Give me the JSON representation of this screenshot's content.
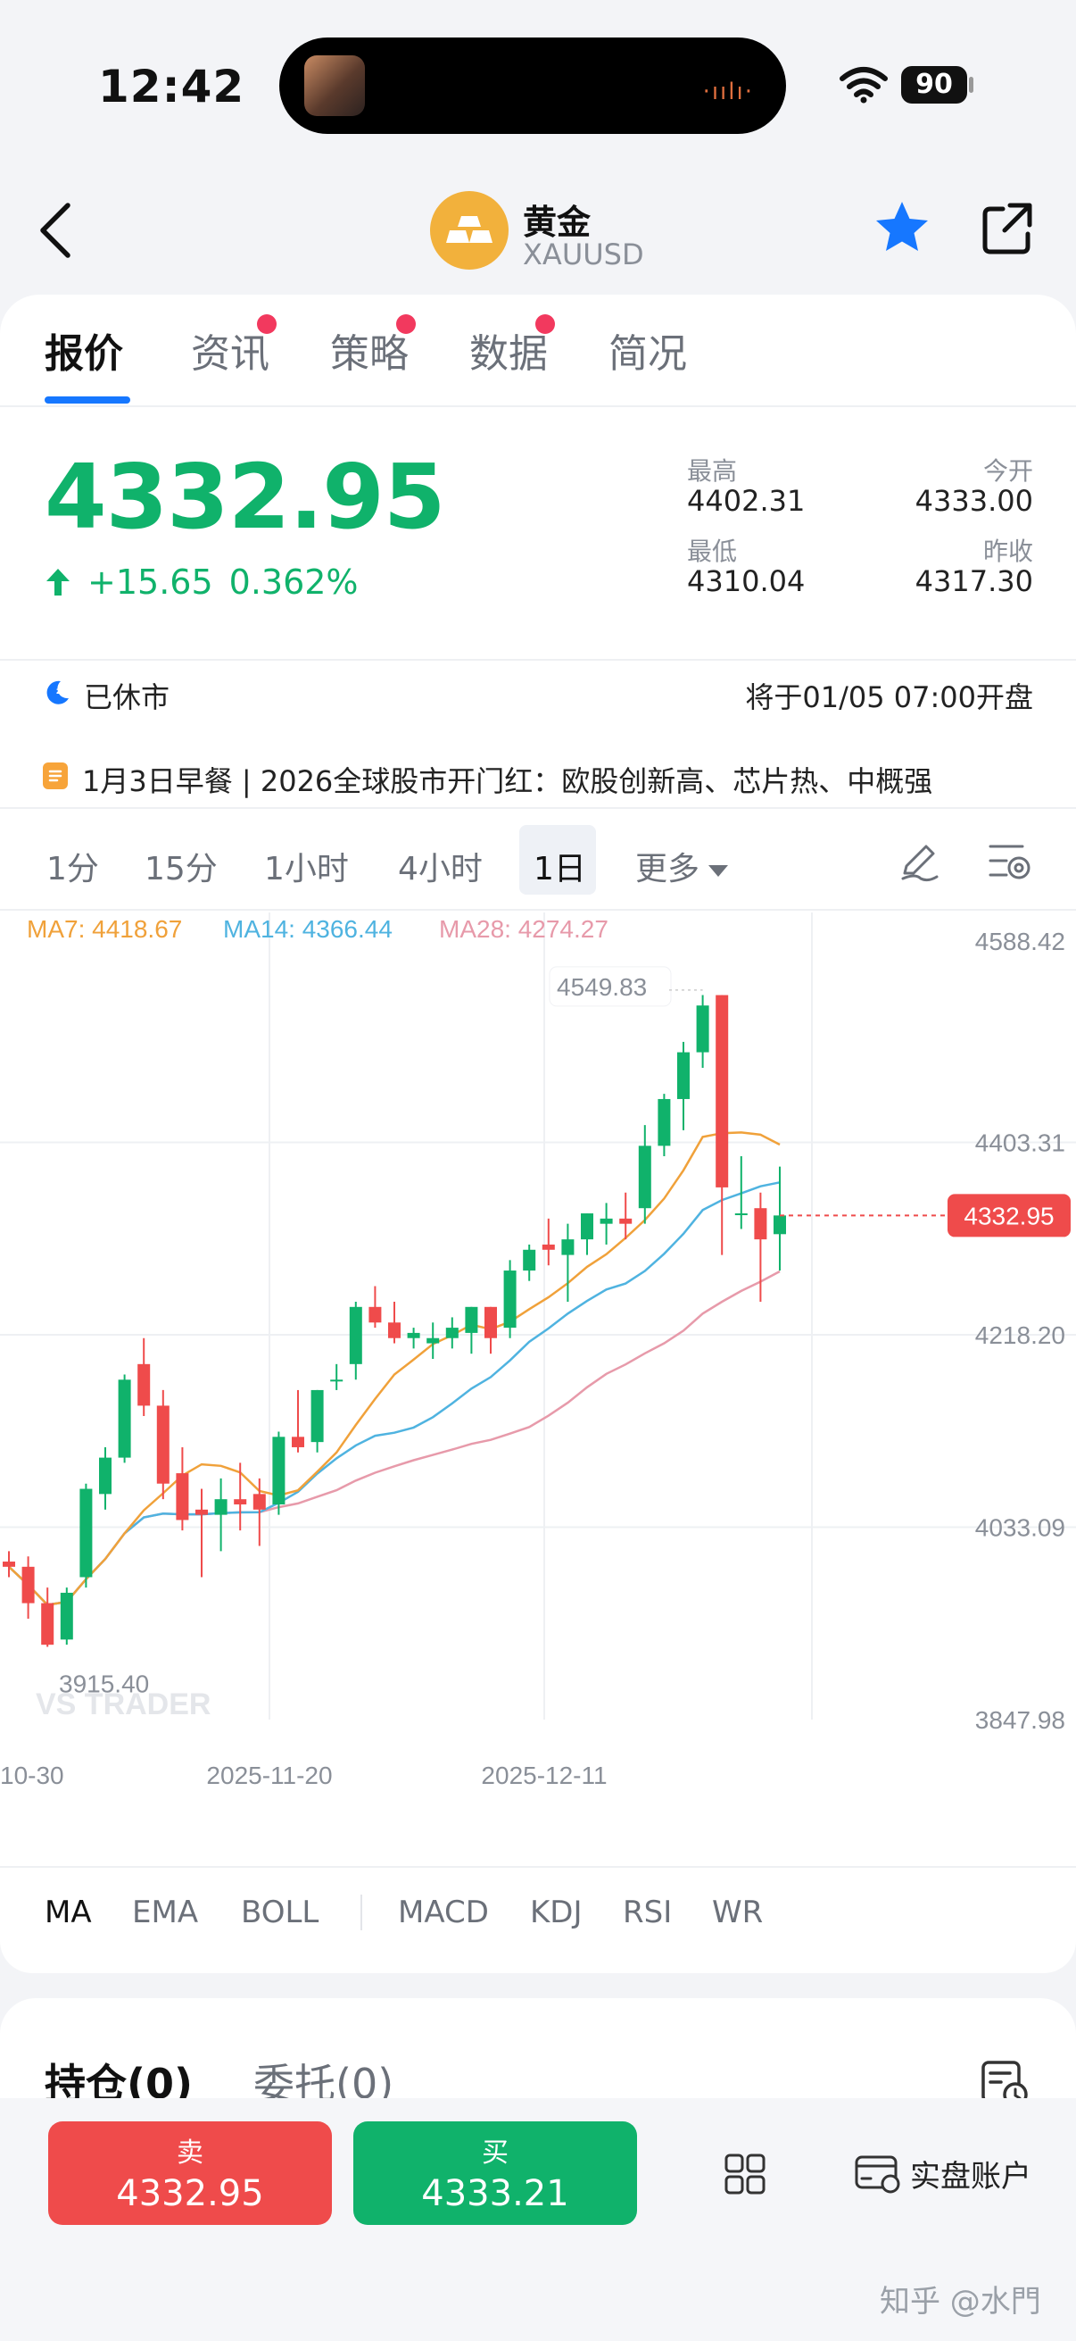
{
  "status_bar": {
    "time": "12:42",
    "battery": "90"
  },
  "header": {
    "name": "黄金",
    "code": "XAUUSD"
  },
  "tabs": [
    {
      "label": "报价",
      "active": true,
      "dot": false
    },
    {
      "label": "资讯",
      "active": false,
      "dot": true
    },
    {
      "label": "策略",
      "active": false,
      "dot": true
    },
    {
      "label": "数据",
      "active": false,
      "dot": true
    },
    {
      "label": "简况",
      "active": false,
      "dot": false
    }
  ],
  "quote": {
    "price": "4332.95",
    "change": "+15.65",
    "change_pct": "0.362%",
    "high_label": "最高",
    "high": "4402.31",
    "open_label": "今开",
    "open": "4333.00",
    "low_label": "最低",
    "low": "4310.04",
    "prev_close_label": "昨收",
    "prev_close": "4317.30"
  },
  "market": {
    "status": "已休市",
    "next_open": "将于01/05 07:00开盘"
  },
  "news": {
    "headline": "1月3日早餐 | 2026全球股市开门红：欧股创新高、芯片热、中概强"
  },
  "periods": [
    {
      "label": "1分",
      "active": false
    },
    {
      "label": "15分",
      "active": false
    },
    {
      "label": "1小时",
      "active": false
    },
    {
      "label": "4小时",
      "active": false
    },
    {
      "label": "1日",
      "active": true
    },
    {
      "label": "更多",
      "active": false
    }
  ],
  "indicators": [
    "MA",
    "EMA",
    "BOLL",
    "MACD",
    "KDJ",
    "RSI",
    "WR"
  ],
  "positions": {
    "holdings": "持仓(0)",
    "orders": "委托(0)"
  },
  "trade": {
    "sell_label": "卖",
    "sell_price": "4332.95",
    "buy_label": "买",
    "buy_price": "4333.21",
    "account": "实盘账户"
  },
  "watermark": "知乎 @水門",
  "colors": {
    "up": "#10b26b",
    "down": "#ef4b4b",
    "accent": "#1677ff",
    "ma7": "#f0a13a",
    "ma14": "#4fb3e0",
    "ma28": "#e79aaa"
  },
  "chart_data": {
    "type": "candlestick",
    "legend": [
      {
        "name": "MA7",
        "value": "4418.67"
      },
      {
        "name": "MA14",
        "value": "4366.44"
      },
      {
        "name": "MA28",
        "value": "4274.27"
      }
    ],
    "y_ticks": [
      "4588.42",
      "4403.31",
      "4218.20",
      "4033.09",
      "3847.98"
    ],
    "ylim": [
      3847.98,
      4588.42
    ],
    "x_ticks": [
      "10-30",
      "2025-11-20",
      "2025-12-11"
    ],
    "max_label": "4549.83",
    "min_label": "3915.40",
    "last_price": "4332.95",
    "watermark": "VS TRADER",
    "candles": [
      [
        4000,
        4010,
        3985,
        3995
      ],
      [
        3995,
        4005,
        3945,
        3960
      ],
      [
        3960,
        3975,
        3918,
        3920
      ],
      [
        3925,
        3975,
        3920,
        3970
      ],
      [
        3985,
        4075,
        3975,
        4070
      ],
      [
        4065,
        4110,
        4050,
        4100
      ],
      [
        4100,
        4180,
        4095,
        4175
      ],
      [
        4190,
        4215,
        4140,
        4150
      ],
      [
        4150,
        4165,
        4060,
        4075
      ],
      [
        4085,
        4110,
        4030,
        4040
      ],
      [
        4050,
        4070,
        3985,
        4045
      ],
      [
        4045,
        4080,
        4010,
        4060
      ],
      [
        4060,
        4095,
        4030,
        4055
      ],
      [
        4065,
        4080,
        4015,
        4050
      ],
      [
        4055,
        4125,
        4045,
        4120
      ],
      [
        4120,
        4165,
        4105,
        4110
      ],
      [
        4115,
        4165,
        4105,
        4165
      ],
      [
        4175,
        4190,
        4165,
        4175
      ],
      [
        4190,
        4250,
        4175,
        4245
      ],
      [
        4245,
        4265,
        4225,
        4230
      ],
      [
        4230,
        4250,
        4210,
        4215
      ],
      [
        4215,
        4225,
        4205,
        4220
      ],
      [
        4210,
        4230,
        4195,
        4215
      ],
      [
        4215,
        4235,
        4205,
        4225
      ],
      [
        4220,
        4245,
        4200,
        4245
      ],
      [
        4245,
        4245,
        4200,
        4215
      ],
      [
        4225,
        4290,
        4215,
        4280
      ],
      [
        4280,
        4305,
        4270,
        4300
      ],
      [
        4305,
        4330,
        4285,
        4300
      ],
      [
        4295,
        4325,
        4250,
        4310
      ],
      [
        4310,
        4335,
        4295,
        4335
      ],
      [
        4325,
        4345,
        4305,
        4330
      ],
      [
        4330,
        4355,
        4310,
        4325
      ],
      [
        4340,
        4420,
        4325,
        4400
      ],
      [
        4400,
        4450,
        4390,
        4445
      ],
      [
        4445,
        4500,
        4415,
        4490
      ],
      [
        4490,
        4545,
        4475,
        4535
      ],
      [
        4545,
        4545,
        4295,
        4360
      ],
      [
        4335,
        4390,
        4320,
        4335
      ],
      [
        4340,
        4355,
        4250,
        4310
      ],
      [
        4315,
        4380,
        4280,
        4333
      ]
    ]
  }
}
